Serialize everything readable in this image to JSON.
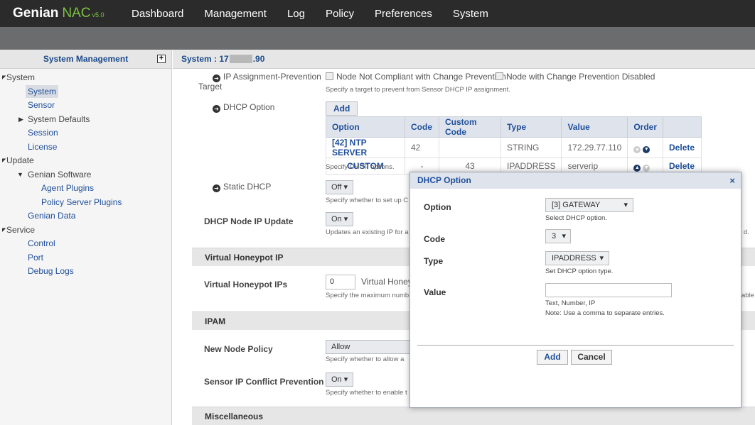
{
  "app": {
    "brand": "Genian",
    "product": "NAC",
    "version": "v5.0"
  },
  "nav": [
    "Dashboard",
    "Management",
    "Log",
    "Policy",
    "Preferences",
    "System"
  ],
  "sidebar": {
    "title": "System Management",
    "plus": "+",
    "tree": {
      "system_group": "System",
      "system": "System",
      "sensor": "Sensor",
      "system_defaults": "System Defaults",
      "session": "Session",
      "license": "License",
      "update_group": "Update",
      "genian_software": "Genian Software",
      "agent_plugins": "Agent Plugins",
      "policy_server_plugins": "Policy Server Plugins",
      "genian_data": "Genian Data",
      "service_group": "Service",
      "control": "Control",
      "port": "Port",
      "debug_logs": "Debug Logs"
    }
  },
  "main": {
    "title_prefix": "System : 17",
    "title_suffix": ".90",
    "ip_prevention": {
      "label": "IP Assignment-Prevention",
      "label2": "Target",
      "check1": "Node Not Compliant with Change Prevention",
      "check2": "Node with Change Prevention Disabled",
      "hint": "Specify a target to prevent from Sensor DHCP IP assignment."
    },
    "dhcp_option": {
      "label": "DHCP Option",
      "add": "Add",
      "hint": "Specify DHCP options.",
      "columns": [
        "Option",
        "Code",
        "Custom Code",
        "Type",
        "Value",
        "Order",
        ""
      ],
      "rows": [
        {
          "option": "[42] NTP SERVER",
          "code": "42",
          "custom": "",
          "type": "STRING",
          "value": "172.29.77.110",
          "delete": "Delete"
        },
        {
          "option": "CUSTOM",
          "code": "-",
          "custom": "43",
          "type": "IPADDRESS",
          "value": "serverip",
          "delete": "Delete"
        }
      ]
    },
    "static_dhcp": {
      "label": "Static DHCP",
      "value": "Off",
      "hint": "Specify whether to set up C"
    },
    "dhcp_node_update": {
      "label": "DHCP Node IP Update",
      "value": "On",
      "hint": "Updates an existing IP for a",
      "tail": "d."
    },
    "honeypot_section": "Virtual Honeypot IP",
    "honeypot": {
      "label": "Virtual Honeypot IPs",
      "value": "0",
      "suffix": "Virtual Honeyp",
      "hint": "Specify the maximum numb",
      "tail": "able"
    },
    "ipam_section": "IPAM",
    "new_node_policy": {
      "label": "New Node Policy",
      "value": "Allow",
      "hint": "Specify whether to allow a"
    },
    "sensor_conflict": {
      "label": "Sensor IP Conflict Prevention",
      "value": "On",
      "hint": "Specify whether to enable t"
    },
    "misc_section": "Miscellaneous"
  },
  "modal": {
    "title": "DHCP Option",
    "close": "×",
    "option": {
      "label": "Option",
      "value": "[3] GATEWAY",
      "hint": "Select DHCP option."
    },
    "code": {
      "label": "Code",
      "value": "3"
    },
    "type": {
      "label": "Type",
      "value": "IPADDRESS",
      "hint": "Set DHCP option type."
    },
    "value": {
      "label": "Value",
      "hint1": "Text, Number, IP",
      "hint2": "Note: Use a comma to separate entries."
    },
    "add": "Add",
    "cancel": "Cancel"
  }
}
